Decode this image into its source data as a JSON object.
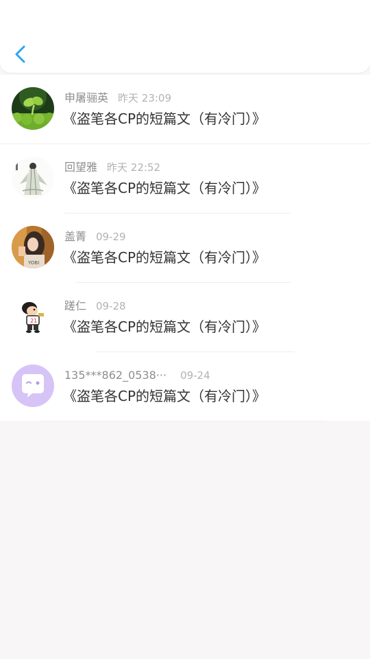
{
  "header": {
    "back_icon": "chevron-left-icon",
    "accent_color": "#2aa6f0"
  },
  "items": [
    {
      "username": "申屠骊英",
      "time": "昨天 23:09",
      "message": "《盗笔各CP的短篇文（有冷门）》",
      "avatar_icon": "seedling-sprout-avatar"
    },
    {
      "username": "回望雅",
      "time": "昨天 22:52",
      "message": "《盗笔各CP的短篇文（有冷门）》",
      "avatar_icon": "ink-robed-figure-avatar"
    },
    {
      "username": "盖菁",
      "time": "09-29",
      "message": "《盗笔各CP的短篇文（有冷门）》",
      "avatar_icon": "girl-photo-avatar"
    },
    {
      "username": "蹉仁",
      "time": "09-28",
      "message": "《盗笔各CP的短篇文（有冷门）》",
      "avatar_icon": "cartoon-boy-avatar"
    },
    {
      "username": "135***862_0538···",
      "time": "09-24",
      "message": "《盗笔各CP的短篇文（有冷门）》",
      "avatar_icon": "chat-bubble-avatar"
    }
  ]
}
